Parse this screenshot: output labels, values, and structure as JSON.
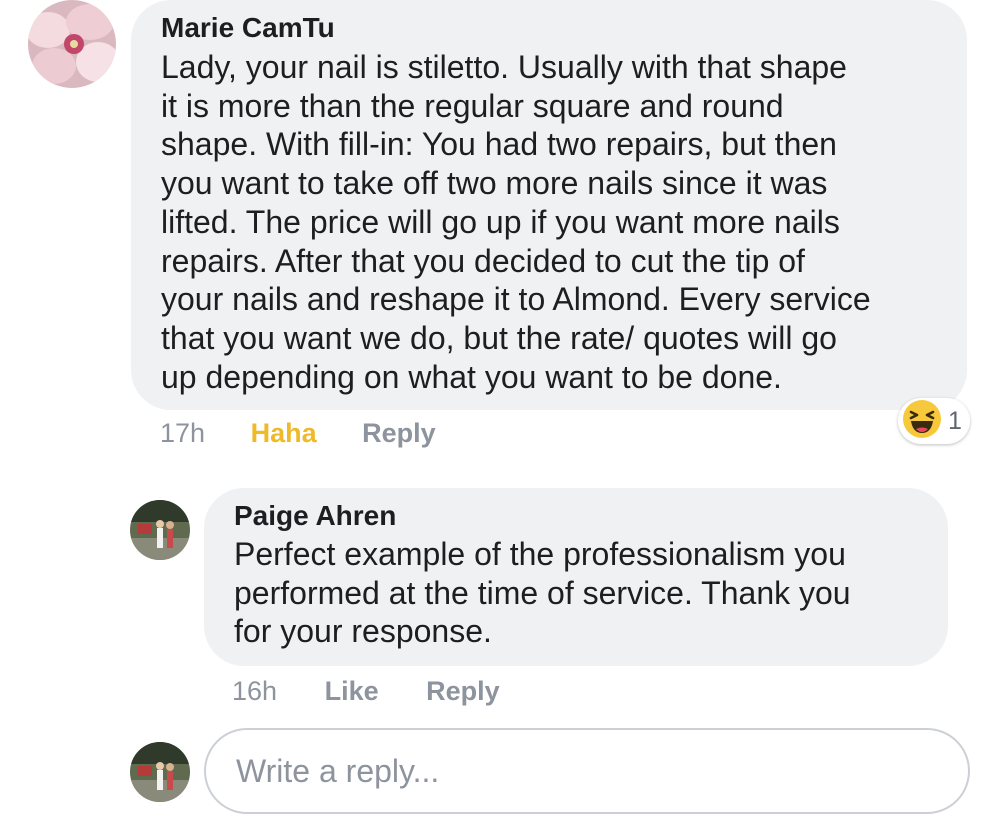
{
  "comment": {
    "author": "Marie CamTu",
    "text_lines": [
      "Lady, your nail is stiletto. Usually with that shape",
      "it is more than the regular square and round",
      "shape. With fill-in: You had two repairs, but then",
      "you want to take off two more nails since it was",
      "lifted. The price will go up if you want more nails",
      "repairs. After that you decided to cut the tip of",
      "your nails and reshape it to Almond. Every service",
      "that you want we do, but the rate/ quotes will go",
      "up depending on what you want to be done."
    ],
    "time": "17h",
    "reaction_action": "Haha",
    "reply_action": "Reply",
    "reaction_count": "1",
    "reaction_icon": "haha-emoji-icon",
    "reaction_color": "#f0b928"
  },
  "reply": {
    "author": "Paige Ahren",
    "text_lines": [
      "Perfect example of the professionalism you",
      "performed at the time of service. Thank you",
      "for your response."
    ],
    "time": "16h",
    "like_action": "Like",
    "reply_action": "Reply"
  },
  "composer": {
    "placeholder": "Write a reply..."
  },
  "colors": {
    "bubble": "#f0f1f3",
    "meta": "#8d949e",
    "input_border": "#ccd0d5"
  }
}
